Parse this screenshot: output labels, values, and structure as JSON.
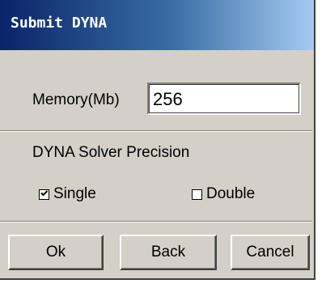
{
  "window": {
    "title": "Submit DYNA"
  },
  "memory": {
    "label": "Memory(Mb)",
    "value": "256"
  },
  "precision": {
    "label": "DYNA Solver Precision",
    "options": [
      {
        "label": "Single",
        "checked": true
      },
      {
        "label": "Double",
        "checked": false
      }
    ]
  },
  "buttons": {
    "ok": "Ok",
    "back": "Back",
    "cancel": "Cancel"
  },
  "colors": {
    "titlebar_start": "#0a246a",
    "titlebar_end": "#a6caf0",
    "face": "#d4d0c8"
  }
}
